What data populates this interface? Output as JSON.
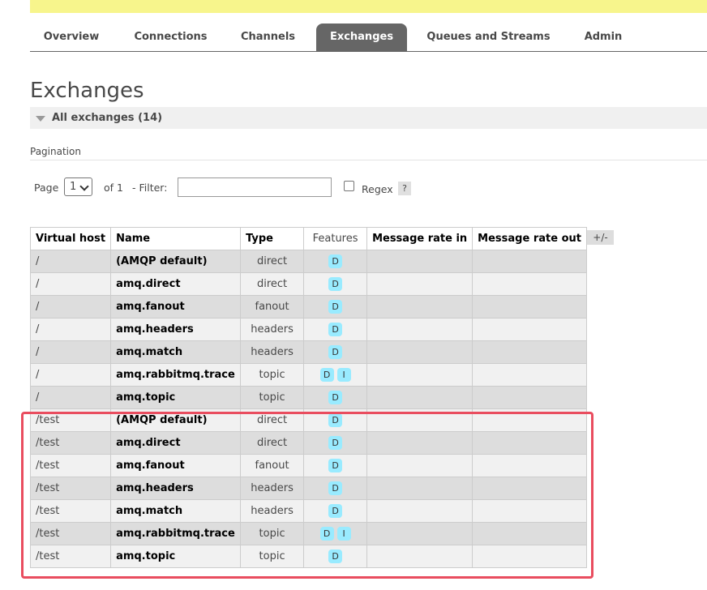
{
  "nav": {
    "tabs": [
      {
        "label": "Overview",
        "active": false
      },
      {
        "label": "Connections",
        "active": false
      },
      {
        "label": "Channels",
        "active": false
      },
      {
        "label": "Exchanges",
        "active": true
      },
      {
        "label": "Queues and Streams",
        "active": false
      },
      {
        "label": "Admin",
        "active": false
      }
    ]
  },
  "page": {
    "title": "Exchanges",
    "section_title": "All exchanges (14)",
    "pagination_label": "Pagination"
  },
  "pager": {
    "page_label": "Page",
    "page_value": "1",
    "of_label": "of 1",
    "filter_label": "- Filter:",
    "filter_value": "",
    "regex_label": "Regex",
    "regex_checked": false,
    "help_label": "?"
  },
  "table": {
    "headers": [
      "Virtual host",
      "Name",
      "Type",
      "Features",
      "Message rate in",
      "Message rate out"
    ],
    "column_toggle": "+/-",
    "rows": [
      {
        "vhost": "/",
        "name": "(AMQP default)",
        "type": "direct",
        "features": [
          "D"
        ],
        "rate_in": "",
        "rate_out": ""
      },
      {
        "vhost": "/",
        "name": "amq.direct",
        "type": "direct",
        "features": [
          "D"
        ],
        "rate_in": "",
        "rate_out": ""
      },
      {
        "vhost": "/",
        "name": "amq.fanout",
        "type": "fanout",
        "features": [
          "D"
        ],
        "rate_in": "",
        "rate_out": ""
      },
      {
        "vhost": "/",
        "name": "amq.headers",
        "type": "headers",
        "features": [
          "D"
        ],
        "rate_in": "",
        "rate_out": ""
      },
      {
        "vhost": "/",
        "name": "amq.match",
        "type": "headers",
        "features": [
          "D"
        ],
        "rate_in": "",
        "rate_out": ""
      },
      {
        "vhost": "/",
        "name": "amq.rabbitmq.trace",
        "type": "topic",
        "features": [
          "D",
          "I"
        ],
        "rate_in": "",
        "rate_out": ""
      },
      {
        "vhost": "/",
        "name": "amq.topic",
        "type": "topic",
        "features": [
          "D"
        ],
        "rate_in": "",
        "rate_out": ""
      },
      {
        "vhost": "/test",
        "name": "(AMQP default)",
        "type": "direct",
        "features": [
          "D"
        ],
        "rate_in": "",
        "rate_out": ""
      },
      {
        "vhost": "/test",
        "name": "amq.direct",
        "type": "direct",
        "features": [
          "D"
        ],
        "rate_in": "",
        "rate_out": ""
      },
      {
        "vhost": "/test",
        "name": "amq.fanout",
        "type": "fanout",
        "features": [
          "D"
        ],
        "rate_in": "",
        "rate_out": ""
      },
      {
        "vhost": "/test",
        "name": "amq.headers",
        "type": "headers",
        "features": [
          "D"
        ],
        "rate_in": "",
        "rate_out": ""
      },
      {
        "vhost": "/test",
        "name": "amq.match",
        "type": "headers",
        "features": [
          "D"
        ],
        "rate_in": "",
        "rate_out": ""
      },
      {
        "vhost": "/test",
        "name": "amq.rabbitmq.trace",
        "type": "topic",
        "features": [
          "D",
          "I"
        ],
        "rate_in": "",
        "rate_out": ""
      },
      {
        "vhost": "/test",
        "name": "amq.topic",
        "type": "topic",
        "features": [
          "D"
        ],
        "rate_in": "",
        "rate_out": ""
      }
    ]
  },
  "colors": {
    "banner": "#f7f58c",
    "tab_active_bg": "#666666",
    "row_odd": "#dddddd",
    "row_even": "#f1f1f1",
    "feature_badge": "#99ebff",
    "highlight_border": "#e94d5f"
  }
}
